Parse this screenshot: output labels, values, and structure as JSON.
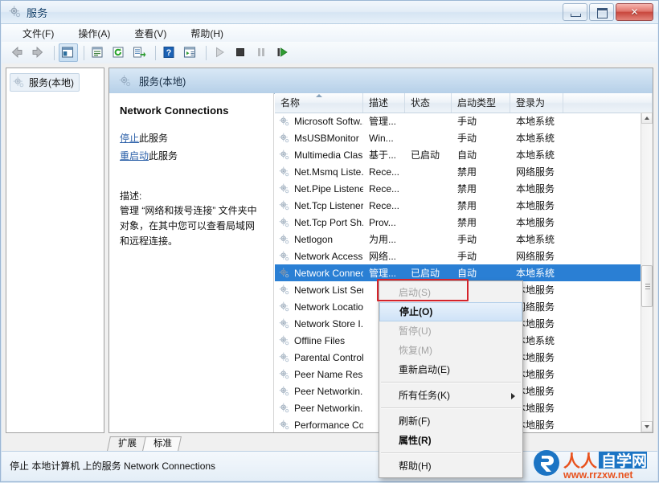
{
  "window": {
    "title": "服务",
    "icon": "services-gear-icon",
    "buttons": {
      "minimize": "最小化",
      "maximize": "最大化",
      "close": "关闭"
    }
  },
  "menubar": {
    "items": [
      {
        "label": "文件(F)",
        "name": "menu-file"
      },
      {
        "label": "操作(A)",
        "name": "menu-action"
      },
      {
        "label": "查看(V)",
        "name": "menu-view"
      },
      {
        "label": "帮助(H)",
        "name": "menu-help"
      }
    ]
  },
  "toolbar": {
    "items": [
      {
        "name": "back-icon",
        "title": "后退"
      },
      {
        "name": "forward-icon",
        "title": "前进"
      },
      {
        "name": "show-tree-icon",
        "title": "显示/隐藏控制台树"
      },
      {
        "name": "properties-icon",
        "title": "属性"
      },
      {
        "name": "refresh-icon",
        "title": "刷新"
      },
      {
        "name": "export-list-icon",
        "title": "导出列表"
      },
      {
        "name": "help-icon",
        "title": "帮助"
      },
      {
        "name": "show-action-pane-icon",
        "title": "显示操作窗格"
      },
      {
        "name": "start-service-icon",
        "title": "启动服务"
      },
      {
        "name": "stop-service-icon",
        "title": "停止服务"
      },
      {
        "name": "pause-service-icon",
        "title": "暂停服务"
      },
      {
        "name": "restart-service-icon",
        "title": "重新启动服务"
      }
    ]
  },
  "tree": {
    "root_label": "服务(本地)"
  },
  "pane": {
    "header": "服务(本地)"
  },
  "detail": {
    "service_title": "Network Connections",
    "links": [
      {
        "link_text": "停止",
        "suffix": "此服务"
      },
      {
        "link_text": "重启动",
        "suffix": "此服务"
      }
    ],
    "description_label": "描述:",
    "description_body": "管理 “网络和拨号连接” 文件夹中对象，在其中您可以查看局域网和远程连接。"
  },
  "list": {
    "columns": [
      {
        "label": "名称",
        "sorted": true
      },
      {
        "label": "描述",
        "sorted": false
      },
      {
        "label": "状态",
        "sorted": false
      },
      {
        "label": "启动类型",
        "sorted": false
      },
      {
        "label": "登录为",
        "sorted": false
      }
    ],
    "rows": [
      {
        "name": "Microsoft Softw...",
        "desc": "管理...",
        "status": "",
        "startup": "手动",
        "logon": "本地系统",
        "selected": false
      },
      {
        "name": "MsUSBMonitor",
        "desc": "Win...",
        "status": "",
        "startup": "手动",
        "logon": "本地系统",
        "selected": false
      },
      {
        "name": "Multimedia Clas...",
        "desc": "基于...",
        "status": "已启动",
        "startup": "自动",
        "logon": "本地系统",
        "selected": false
      },
      {
        "name": "Net.Msmq Liste...",
        "desc": "Rece...",
        "status": "",
        "startup": "禁用",
        "logon": "网络服务",
        "selected": false
      },
      {
        "name": "Net.Pipe Listene...",
        "desc": "Rece...",
        "status": "",
        "startup": "禁用",
        "logon": "本地服务",
        "selected": false
      },
      {
        "name": "Net.Tcp Listener...",
        "desc": "Rece...",
        "status": "",
        "startup": "禁用",
        "logon": "本地服务",
        "selected": false
      },
      {
        "name": "Net.Tcp Port Sh...",
        "desc": "Prov...",
        "status": "",
        "startup": "禁用",
        "logon": "本地服务",
        "selected": false
      },
      {
        "name": "Netlogon",
        "desc": "为用...",
        "status": "",
        "startup": "手动",
        "logon": "本地系统",
        "selected": false
      },
      {
        "name": "Network Access ...",
        "desc": "网络...",
        "status": "",
        "startup": "手动",
        "logon": "网络服务",
        "selected": false
      },
      {
        "name": "Network Connec...",
        "desc": "管理...",
        "status": "已启动",
        "startup": "自动",
        "logon": "本地系统",
        "selected": true
      },
      {
        "name": "Network List Ser...",
        "desc": "",
        "status": "",
        "startup": "",
        "logon": "本地服务",
        "selected": false
      },
      {
        "name": "Network Locatio...",
        "desc": "",
        "status": "",
        "startup": "",
        "logon": "网络服务",
        "selected": false
      },
      {
        "name": "Network Store I...",
        "desc": "",
        "status": "",
        "startup": "",
        "logon": "本地服务",
        "selected": false
      },
      {
        "name": "Offline Files",
        "desc": "",
        "status": "",
        "startup": "",
        "logon": "本地系统",
        "selected": false
      },
      {
        "name": "Parental Controls",
        "desc": "",
        "status": "",
        "startup": "",
        "logon": "本地服务",
        "selected": false
      },
      {
        "name": "Peer Name Res...",
        "desc": "",
        "status": "",
        "startup": "",
        "logon": "本地服务",
        "selected": false
      },
      {
        "name": "Peer Networkin...",
        "desc": "",
        "status": "",
        "startup": "",
        "logon": "本地服务",
        "selected": false
      },
      {
        "name": "Peer Networkin...",
        "desc": "",
        "status": "",
        "startup": "",
        "logon": "本地服务",
        "selected": false
      },
      {
        "name": "Performance Co...",
        "desc": "",
        "status": "",
        "startup": "",
        "logon": "本地服务",
        "selected": false
      }
    ]
  },
  "context_menu": {
    "items": [
      {
        "label": "启动(S)",
        "state": "disabled",
        "name": "ctx-start"
      },
      {
        "label": "停止(O)",
        "state": "hover",
        "name": "ctx-stop"
      },
      {
        "label": "暂停(U)",
        "state": "disabled",
        "name": "ctx-pause"
      },
      {
        "label": "恢复(M)",
        "state": "disabled",
        "name": "ctx-resume"
      },
      {
        "label": "重新启动(E)",
        "state": "normal",
        "name": "ctx-restart"
      },
      {
        "label": "所有任务(K)",
        "state": "submenu",
        "name": "ctx-all-tasks"
      },
      {
        "label": "刷新(F)",
        "state": "normal",
        "name": "ctx-refresh"
      },
      {
        "label": "属性(R)",
        "state": "bold",
        "name": "ctx-properties"
      },
      {
        "label": "帮助(H)",
        "state": "normal",
        "name": "ctx-help"
      }
    ]
  },
  "tabs": [
    {
      "label": "扩展",
      "active": false
    },
    {
      "label": "标准",
      "active": true
    }
  ],
  "statusbar": {
    "text": "停止 本地计算机 上的服务 Network Connections"
  },
  "watermark": {
    "brand": "人人自学网",
    "url": "www.rrzxw.net"
  },
  "colors": {
    "selection_blue": "#2a7fd4",
    "annotation_red": "#d5222a",
    "link_blue": "#2a5fa8",
    "header_blue": "#b6d0e8"
  }
}
